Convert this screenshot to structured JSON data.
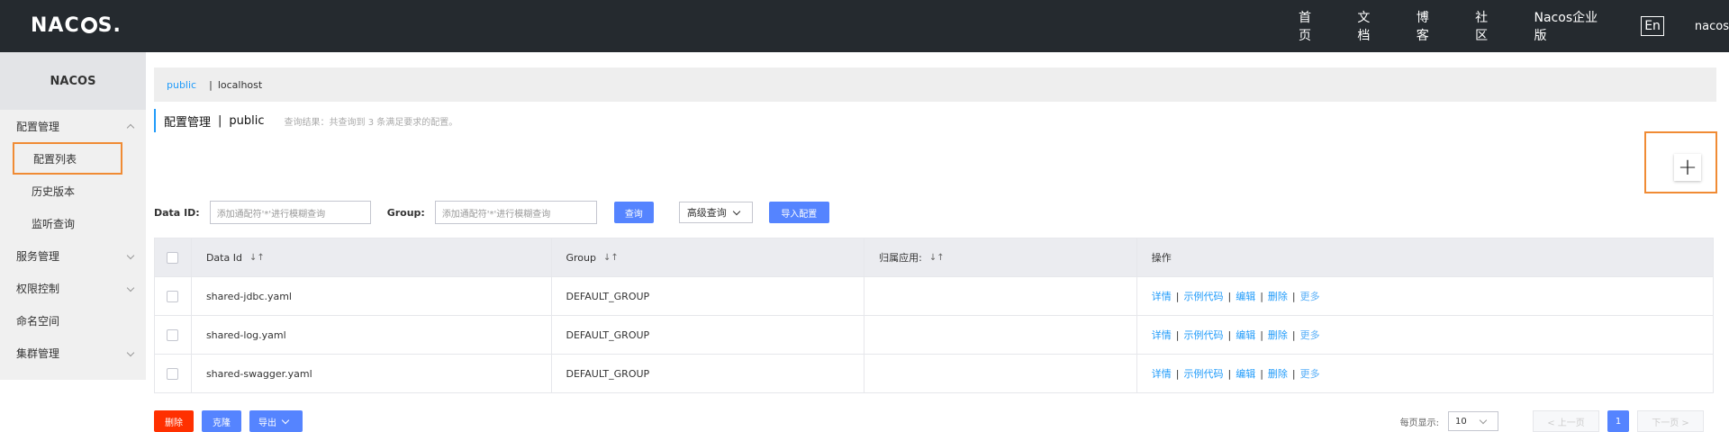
{
  "colors": {
    "topbar": "#252a2f",
    "accent": "#209bfa",
    "primary": "#5584ff",
    "danger": "#ff3000",
    "highlight": "#f08b34"
  },
  "header": {
    "logo_left": "NAC",
    "logo_right": "S.",
    "nav": [
      "首页",
      "文档",
      "博客",
      "社区",
      "Nacos企业版"
    ],
    "lang": "En",
    "user": "nacos"
  },
  "sidebar": {
    "title": "NACOS",
    "config_group": "配置管理",
    "config_items": [
      "配置列表",
      "历史版本",
      "监听查询"
    ],
    "groups": [
      "服务管理",
      "权限控制",
      "命名空间",
      "集群管理"
    ]
  },
  "namespace": {
    "active": "public",
    "separator": "|",
    "other": "localhost"
  },
  "title": {
    "text": "配置管理",
    "separator": "|",
    "ns": "public",
    "result": "查询结果：共查询到 3 条满足要求的配置。"
  },
  "search": {
    "data_id_label": "Data ID:",
    "data_id_placeholder": "添加通配符'*'进行模糊查询",
    "group_label": "Group:",
    "group_placeholder": "添加通配符'*'进行模糊查询",
    "query": "查询",
    "advanced": "高级查询",
    "import": "导入配置"
  },
  "add_button": "+",
  "table": {
    "headers": [
      "Data Id",
      "Group",
      "归属应用:",
      "操作"
    ],
    "sort_icon": "↓↑",
    "rows": [
      {
        "data_id": "shared-jdbc.yaml",
        "group": "DEFAULT_GROUP",
        "app": ""
      },
      {
        "data_id": "shared-log.yaml",
        "group": "DEFAULT_GROUP",
        "app": ""
      },
      {
        "data_id": "shared-swagger.yaml",
        "group": "DEFAULT_GROUP",
        "app": ""
      }
    ],
    "ops": [
      "详情",
      "示例代码",
      "编辑",
      "删除"
    ],
    "more": "更多",
    "op_separator": "|"
  },
  "footer": {
    "delete": "删除",
    "clone": "克隆",
    "export": "导出",
    "page_size_label": "每页显示:",
    "page_size": "10",
    "prev": "< 上一页",
    "current_page": "1",
    "next": "下一页 >"
  }
}
